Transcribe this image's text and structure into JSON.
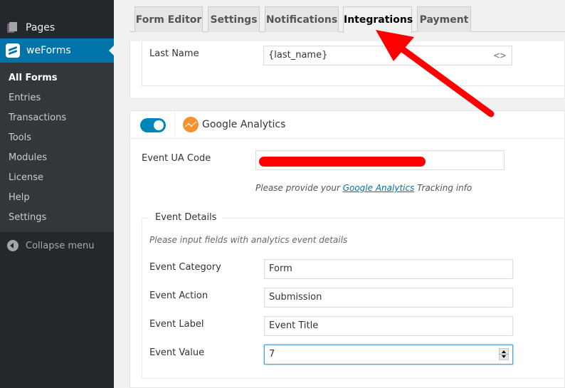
{
  "sidebar": {
    "pages_label": "Pages",
    "active_label": "weForms",
    "items": [
      {
        "label": "All Forms",
        "current": true
      },
      {
        "label": "Entries"
      },
      {
        "label": "Transactions"
      },
      {
        "label": "Tools"
      },
      {
        "label": "Modules"
      },
      {
        "label": "License"
      },
      {
        "label": "Help"
      },
      {
        "label": "Settings"
      }
    ],
    "collapse_label": "Collapse menu"
  },
  "tabs": [
    {
      "label": "Form Editor"
    },
    {
      "label": "Settings"
    },
    {
      "label": "Notifications"
    },
    {
      "label": "Integrations",
      "active": true
    },
    {
      "label": "Payment"
    }
  ],
  "previous_integration": {
    "last_name_label": "Last Name",
    "last_name_value": "{last_name}"
  },
  "google_analytics": {
    "enabled": true,
    "title": "Google Analytics",
    "ua_code_label": "Event UA Code",
    "ua_code_value": "",
    "help_prefix": "Please provide your ",
    "help_link": "Google Analytics",
    "help_suffix": " Tracking info",
    "event_details": {
      "legend": "Event Details",
      "description": "Please input fields with analytics event details",
      "fields": [
        {
          "label": "Event Category",
          "value": "Form"
        },
        {
          "label": "Event Action",
          "value": "Submission"
        },
        {
          "label": "Event Label",
          "value": "Event Title"
        },
        {
          "label": "Event Value",
          "value": "7"
        }
      ]
    }
  },
  "colors": {
    "sidebar_bg": "#23282d",
    "submenu_bg": "#32373c",
    "active_blue": "#0073aa",
    "toggle_blue": "#0085ba",
    "ga_orange": "#f7912c",
    "annotation_red": "#ff0000"
  }
}
